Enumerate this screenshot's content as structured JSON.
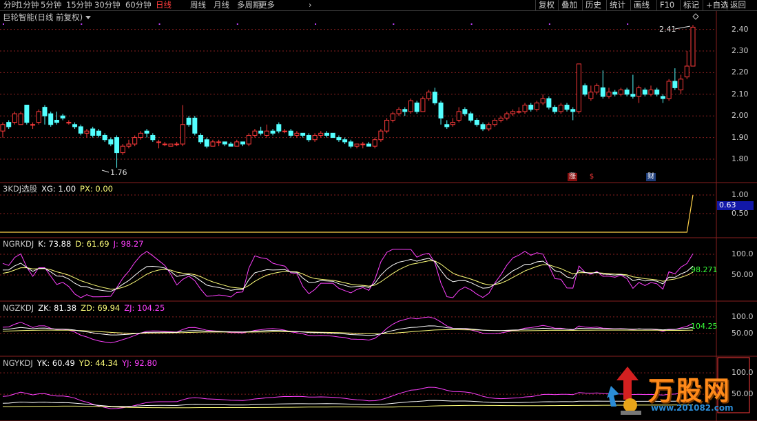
{
  "toolbar": {
    "timeframes": [
      "分时",
      "1分钟",
      "5分钟",
      "15分钟",
      "30分钟",
      "60分钟",
      "日线",
      "周线",
      "月线",
      "多周期",
      "更多"
    ],
    "active_timeframe": "日线",
    "buttons": [
      "复权",
      "叠加",
      "历史",
      "统计",
      "画线",
      "F10",
      "标记",
      "+自选",
      "返回"
    ]
  },
  "panels": {
    "main": {
      "title": "巨轮智能(日线 前复权)",
      "high_label": "2.41",
      "low_label": "1.76",
      "ticks": [
        "2.40",
        "2.30",
        "2.20",
        "2.10",
        "2.00",
        "1.90",
        "1.80"
      ]
    },
    "xg": {
      "name": "3KDJ选股",
      "xg": "XG: 1.00",
      "px": "PX: 0.00",
      "ticks": [
        "1.00",
        "0.50"
      ],
      "current_value": "0.63"
    },
    "ngrkdj": {
      "name": "NGRKDJ",
      "k": "K: 73.88",
      "d": "D: 61.69",
      "j": "J: 98.27",
      "ticks": [
        "100.0",
        "50.00"
      ],
      "right_value": "98.271"
    },
    "ngzkdj": {
      "name": "NGZKDJ",
      "zk": "ZK: 81.38",
      "zd": "ZD: 69.94",
      "zj": "ZJ: 104.25",
      "ticks": [
        "100.0",
        "50.00"
      ],
      "right_value": "104.25"
    },
    "ngykdj": {
      "name": "NGYKDJ",
      "yk": "YK: 60.49",
      "yd": "YD: 44.34",
      "yj": "YJ: 92.80",
      "ticks": [
        "100.0",
        "50.00"
      ]
    }
  },
  "markers": {
    "zhang": "涨",
    "dollar": "$",
    "cai": "财"
  },
  "watermark": {
    "text": "万股网",
    "url": "www.201082.com"
  },
  "colors": {
    "up": "#ff3b3b",
    "down": "#54ffff",
    "k_line": "#ffffff",
    "d_line": "#ffff7a",
    "j_line": "#ff40ff",
    "grid": "#8a1f1f"
  },
  "chart_data": {
    "type": "candlestick",
    "price_range": [
      1.73,
      2.44
    ],
    "candles": [
      [
        1.93,
        1.96,
        1.9,
        1.97
      ],
      [
        1.97,
        1.95,
        1.94,
        1.98
      ],
      [
        1.97,
        2.01,
        1.96,
        2.02
      ],
      [
        1.96,
        2.01,
        1.96,
        2.02
      ],
      [
        2.05,
        1.97,
        1.96,
        2.05
      ],
      [
        1.96,
        1.96,
        1.94,
        1.97
      ],
      [
        1.97,
        2.02,
        1.96,
        2.03
      ],
      [
        2.04,
        2.0,
        1.96,
        2.05
      ],
      [
        2.01,
        1.96,
        1.95,
        2.02
      ],
      [
        1.98,
        1.97,
        1.96,
        2.02
      ],
      [
        2.0,
        1.99,
        1.98,
        2.01
      ],
      [
        1.97,
        1.97,
        1.96,
        1.98
      ],
      [
        1.96,
        1.95,
        1.94,
        1.97
      ],
      [
        1.95,
        1.92,
        1.91,
        1.96
      ],
      [
        1.92,
        1.93,
        1.9,
        1.94
      ],
      [
        1.94,
        1.91,
        1.9,
        1.95
      ],
      [
        1.93,
        1.91,
        1.9,
        1.94
      ],
      [
        1.91,
        1.89,
        1.88,
        1.92
      ],
      [
        1.89,
        1.87,
        1.86,
        1.9
      ],
      [
        1.9,
        1.83,
        1.76,
        1.91
      ],
      [
        1.83,
        1.86,
        1.82,
        1.87
      ],
      [
        1.86,
        1.87,
        1.85,
        1.89
      ],
      [
        1.87,
        1.9,
        1.86,
        1.91
      ],
      [
        1.9,
        1.92,
        1.89,
        1.93
      ],
      [
        1.93,
        1.92,
        1.9,
        1.94
      ],
      [
        1.91,
        1.89,
        1.88,
        1.92
      ],
      [
        1.88,
        1.88,
        1.85,
        1.89
      ],
      [
        1.87,
        1.87,
        1.86,
        1.88
      ],
      [
        1.86,
        1.87,
        1.86,
        1.87
      ],
      [
        1.87,
        1.87,
        1.86,
        1.88
      ],
      [
        1.87,
        1.96,
        1.86,
        2.05
      ],
      [
        1.99,
        1.96,
        1.95,
        2.0
      ],
      [
        1.99,
        1.92,
        1.91,
        2.0
      ],
      [
        1.91,
        1.88,
        1.87,
        1.92
      ],
      [
        1.89,
        1.86,
        1.85,
        1.9
      ],
      [
        1.86,
        1.88,
        1.86,
        1.89
      ],
      [
        1.88,
        1.88,
        1.86,
        1.89
      ],
      [
        1.88,
        1.87,
        1.86,
        1.88
      ],
      [
        1.87,
        1.86,
        1.86,
        1.88
      ],
      [
        1.86,
        1.88,
        1.86,
        1.89
      ],
      [
        1.88,
        1.87,
        1.86,
        1.88
      ],
      [
        1.87,
        1.91,
        1.86,
        1.92
      ],
      [
        1.91,
        1.93,
        1.9,
        1.94
      ],
      [
        1.93,
        1.92,
        1.91,
        1.95
      ],
      [
        1.91,
        1.93,
        1.9,
        1.96
      ],
      [
        1.93,
        1.92,
        1.91,
        1.94
      ],
      [
        1.96,
        1.93,
        1.92,
        1.97
      ],
      [
        1.93,
        1.93,
        1.92,
        1.94
      ],
      [
        1.93,
        1.91,
        1.9,
        1.94
      ],
      [
        1.91,
        1.92,
        1.9,
        1.93
      ],
      [
        1.92,
        1.91,
        1.9,
        1.92
      ],
      [
        1.91,
        1.89,
        1.88,
        1.92
      ],
      [
        1.89,
        1.91,
        1.88,
        1.92
      ],
      [
        1.91,
        1.92,
        1.9,
        1.93
      ],
      [
        1.92,
        1.91,
        1.9,
        1.93
      ],
      [
        1.92,
        1.9,
        1.9,
        1.92
      ],
      [
        1.9,
        1.89,
        1.88,
        1.91
      ],
      [
        1.89,
        1.88,
        1.87,
        1.9
      ],
      [
        1.88,
        1.86,
        1.85,
        1.89
      ],
      [
        1.86,
        1.87,
        1.85,
        1.87
      ],
      [
        1.87,
        1.87,
        1.85,
        1.88
      ],
      [
        1.87,
        1.86,
        1.86,
        1.88
      ],
      [
        1.86,
        1.89,
        1.85,
        1.9
      ],
      [
        1.89,
        1.93,
        1.88,
        1.94
      ],
      [
        1.93,
        1.98,
        1.92,
        1.99
      ],
      [
        1.98,
        2.01,
        1.97,
        2.02
      ],
      [
        2.01,
        2.03,
        2.0,
        2.04
      ],
      [
        2.03,
        2.02,
        2.0,
        2.04
      ],
      [
        2.02,
        2.07,
        2.01,
        2.08
      ],
      [
        2.06,
        2.02,
        2.01,
        2.07
      ],
      [
        2.02,
        2.08,
        2.02,
        2.09
      ],
      [
        2.08,
        2.11,
        2.07,
        2.12
      ],
      [
        2.11,
        2.06,
        2.05,
        2.13
      ],
      [
        2.06,
        1.99,
        1.96,
        2.07
      ],
      [
        1.96,
        1.95,
        1.94,
        1.98
      ],
      [
        1.96,
        1.97,
        1.95,
        1.99
      ],
      [
        1.98,
        2.02,
        1.97,
        2.04
      ],
      [
        2.03,
        2.01,
        2.0,
        2.04
      ],
      [
        2.01,
        1.98,
        1.97,
        2.02
      ],
      [
        1.98,
        1.96,
        1.95,
        1.99
      ],
      [
        1.96,
        1.94,
        1.93,
        1.97
      ],
      [
        1.94,
        1.96,
        1.93,
        1.97
      ],
      [
        1.96,
        1.98,
        1.95,
        1.99
      ],
      [
        1.98,
        1.99,
        1.97,
        2.0
      ],
      [
        1.99,
        2.01,
        1.98,
        2.02
      ],
      [
        2.01,
        2.02,
        2.0,
        2.03
      ],
      [
        2.02,
        2.02,
        2.01,
        2.04
      ],
      [
        2.02,
        2.05,
        2.01,
        2.06
      ],
      [
        2.05,
        2.03,
        2.02,
        2.06
      ],
      [
        2.03,
        2.06,
        2.02,
        2.07
      ],
      [
        2.06,
        2.08,
        2.05,
        2.1
      ],
      [
        2.08,
        2.04,
        2.03,
        2.09
      ],
      [
        2.04,
        2.02,
        2.01,
        2.05
      ],
      [
        2.02,
        2.05,
        2.01,
        2.06
      ],
      [
        2.05,
        2.03,
        2.02,
        2.06
      ],
      [
        2.03,
        2.02,
        1.98,
        2.04
      ],
      [
        2.02,
        2.24,
        2.01,
        2.24
      ],
      [
        2.14,
        2.1,
        2.09,
        2.15
      ],
      [
        2.08,
        2.11,
        2.07,
        2.14
      ],
      [
        2.11,
        2.14,
        2.1,
        2.15
      ],
      [
        2.13,
        2.09,
        2.08,
        2.21
      ],
      [
        2.09,
        2.11,
        2.08,
        2.13
      ],
      [
        2.11,
        2.1,
        2.09,
        2.12
      ],
      [
        2.1,
        2.12,
        2.09,
        2.13
      ],
      [
        2.12,
        2.1,
        2.09,
        2.13
      ],
      [
        2.1,
        2.09,
        2.08,
        2.19
      ],
      [
        2.09,
        2.13,
        2.06,
        2.14
      ],
      [
        2.12,
        2.1,
        2.09,
        2.13
      ],
      [
        2.1,
        2.12,
        2.09,
        2.14
      ],
      [
        2.12,
        2.1,
        2.09,
        2.13
      ],
      [
        2.09,
        2.08,
        2.06,
        2.1
      ],
      [
        2.08,
        2.16,
        2.07,
        2.17
      ],
      [
        2.16,
        2.13,
        2.12,
        2.22
      ],
      [
        2.12,
        2.17,
        2.1,
        2.19
      ],
      [
        2.18,
        2.23,
        2.17,
        2.3
      ],
      [
        2.23,
        2.41,
        2.23,
        2.42
      ]
    ],
    "indicators": {
      "xg": [
        0,
        1
      ],
      "ngrkdj_last": {
        "K": 73.88,
        "D": 61.69,
        "J": 98.27
      },
      "ngzkdj_last": {
        "ZK": 81.38,
        "ZD": 69.94,
        "ZJ": 104.25
      },
      "ngykdj_last": {
        "YK": 60.49,
        "YD": 44.34,
        "YJ": 92.8
      }
    }
  }
}
